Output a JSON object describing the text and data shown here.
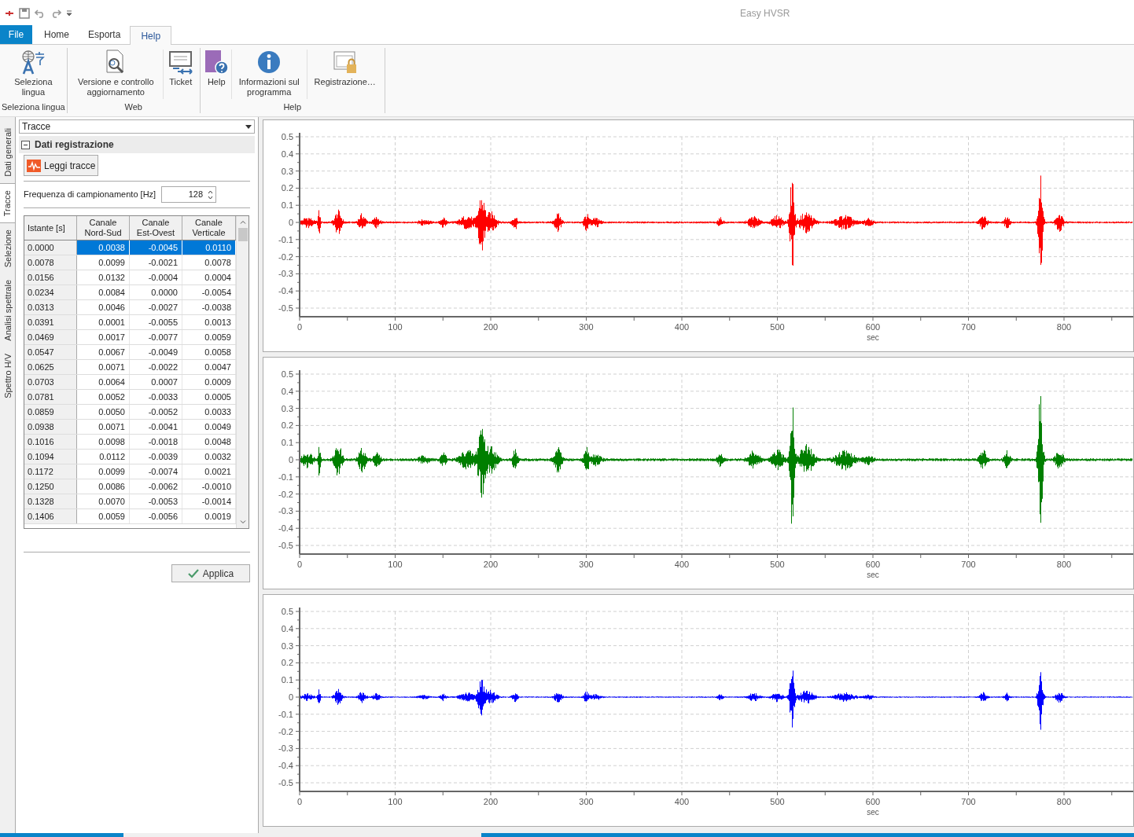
{
  "app": {
    "title": "Easy HVSR"
  },
  "ribbon_tabs": [
    {
      "label": "File",
      "kind": "file",
      "selected": false
    },
    {
      "label": "Home",
      "kind": "tab",
      "selected": false
    },
    {
      "label": "Esporta",
      "kind": "tab",
      "selected": false
    },
    {
      "label": "Help",
      "kind": "tab",
      "selected": true
    }
  ],
  "ribbon_groups": [
    {
      "label": "Seleziona lingua",
      "buttons": [
        {
          "label": "Seleziona lingua",
          "kind": "language"
        }
      ]
    },
    {
      "label": "Web",
      "buttons": [
        {
          "label": "Versione e controllo aggiornamento",
          "kind": "update"
        },
        {
          "label": "Ticket",
          "kind": "ticket"
        }
      ]
    },
    {
      "label": "Help",
      "buttons": [
        {
          "label": "Help",
          "kind": "help"
        },
        {
          "label": "Informazioni sul programma",
          "kind": "info"
        },
        {
          "label": "Registrazione…",
          "kind": "register"
        }
      ]
    }
  ],
  "side_tabs": [
    {
      "label": "Dati generali",
      "selected": false
    },
    {
      "label": "Tracce",
      "selected": true
    },
    {
      "label": "Selezione",
      "selected": false
    },
    {
      "label": "Analisi spettrale",
      "selected": false
    },
    {
      "label": "Spettro H/V",
      "selected": false
    }
  ],
  "panel": {
    "dropdown": "Tracce",
    "section": {
      "title": "Dati registrazione",
      "expanded": true
    },
    "read_button": "Leggi tracce",
    "frequency": {
      "label": "Frequenza di campionamento [Hz]",
      "value": "128"
    },
    "table": {
      "columns": [
        "Istante [s]",
        "Canale Nord-Sud",
        "Canale Est-Ovest",
        "Canale Verticale"
      ],
      "rows": [
        {
          "cells": [
            "0.0000",
            "0.0038",
            "-0.0045",
            "0.0110"
          ],
          "selected": true
        },
        {
          "cells": [
            "0.0078",
            "0.0099",
            "-0.0021",
            "0.0078"
          ],
          "selected": false
        },
        {
          "cells": [
            "0.0156",
            "0.0132",
            "-0.0004",
            "0.0004"
          ],
          "selected": false
        },
        {
          "cells": [
            "0.0234",
            "0.0084",
            "0.0000",
            "-0.0054"
          ],
          "selected": false
        },
        {
          "cells": [
            "0.0313",
            "0.0046",
            "-0.0027",
            "-0.0038"
          ],
          "selected": false
        },
        {
          "cells": [
            "0.0391",
            "0.0001",
            "-0.0055",
            "0.0013"
          ],
          "selected": false
        },
        {
          "cells": [
            "0.0469",
            "0.0017",
            "-0.0077",
            "0.0059"
          ],
          "selected": false
        },
        {
          "cells": [
            "0.0547",
            "0.0067",
            "-0.0049",
            "0.0058"
          ],
          "selected": false
        },
        {
          "cells": [
            "0.0625",
            "0.0071",
            "-0.0022",
            "0.0047"
          ],
          "selected": false
        },
        {
          "cells": [
            "0.0703",
            "0.0064",
            "0.0007",
            "0.0009"
          ],
          "selected": false
        },
        {
          "cells": [
            "0.0781",
            "0.0052",
            "-0.0033",
            "0.0005"
          ],
          "selected": false
        },
        {
          "cells": [
            "0.0859",
            "0.0050",
            "-0.0052",
            "0.0033"
          ],
          "selected": false
        },
        {
          "cells": [
            "0.0938",
            "0.0071",
            "-0.0041",
            "0.0049"
          ],
          "selected": false
        },
        {
          "cells": [
            "0.1016",
            "0.0098",
            "-0.0018",
            "0.0048"
          ],
          "selected": false
        },
        {
          "cells": [
            "0.1094",
            "0.0112",
            "-0.0039",
            "0.0032"
          ],
          "selected": false
        },
        {
          "cells": [
            "0.1172",
            "0.0099",
            "-0.0074",
            "0.0021"
          ],
          "selected": false
        },
        {
          "cells": [
            "0.1250",
            "0.0086",
            "-0.0062",
            "-0.0010"
          ],
          "selected": false
        },
        {
          "cells": [
            "0.1328",
            "0.0070",
            "-0.0053",
            "-0.0014"
          ],
          "selected": false
        },
        {
          "cells": [
            "0.1406",
            "0.0059",
            "-0.0056",
            "0.0019"
          ],
          "selected": false
        }
      ]
    },
    "apply_button": "Applica"
  },
  "charts": [
    {
      "color": "#ff0000",
      "y_labels": [
        "0.5",
        "0.4",
        "0.3",
        "0.2",
        "0.1",
        "0",
        "-0.1",
        "-0.2",
        "-0.3",
        "-0.4",
        "-0.5"
      ],
      "x_labels": [
        "0",
        "100",
        "200",
        "300",
        "400",
        "500",
        "600",
        "700",
        "800"
      ],
      "x_title": "sec"
    },
    {
      "color": "#007f00",
      "y_labels": [
        "0.5",
        "0.4",
        "0.3",
        "0.2",
        "0.1",
        "0",
        "-0.1",
        "-0.2",
        "-0.3",
        "-0.4",
        "-0.5"
      ],
      "x_labels": [
        "0",
        "100",
        "200",
        "300",
        "400",
        "500",
        "600",
        "700",
        "800"
      ],
      "x_title": "sec"
    },
    {
      "color": "#0000ff",
      "y_labels": [
        "0.5",
        "0.4",
        "0.3",
        "0.2",
        "0.1",
        "0",
        "-0.1",
        "-0.2",
        "-0.3",
        "-0.4",
        "-0.5"
      ],
      "x_labels": [
        "0",
        "100",
        "200",
        "300",
        "400",
        "500",
        "600",
        "700",
        "800"
      ],
      "x_title": "sec"
    }
  ]
}
